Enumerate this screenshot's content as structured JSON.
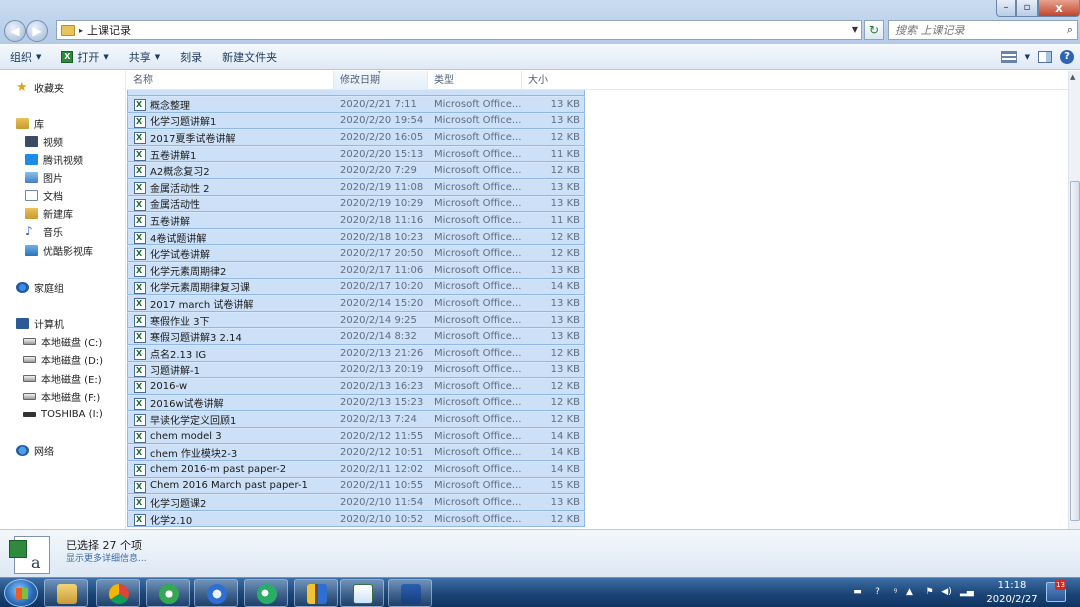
{
  "window": {
    "minimize_glyph": "–",
    "maximize_glyph": "▫",
    "close_glyph": "x"
  },
  "address": {
    "breadcrumb": "上课记录",
    "separator": "▸"
  },
  "search": {
    "placeholder": "搜索 上课记录"
  },
  "toolbar": {
    "organize": "组织",
    "open": "打开",
    "share": "共享",
    "burn": "刻录",
    "new_folder": "新建文件夹"
  },
  "nav": {
    "favorites": "收藏夹",
    "libraries": "库",
    "video": "视频",
    "tencent_video": "腾讯视频",
    "pictures": "图片",
    "documents": "文档",
    "new_library": "新建库",
    "music": "音乐",
    "youku": "优酷影视库",
    "homegroup": "家庭组",
    "computer": "计算机",
    "disk_c": "本地磁盘 (C:)",
    "disk_d": "本地磁盘 (D:)",
    "disk_e": "本地磁盘 (E:)",
    "disk_f": "本地磁盘 (F:)",
    "toshiba": "TOSHIBA (I:)",
    "network": "网络"
  },
  "columns": {
    "name": "名称",
    "date": "修改日期",
    "type": "类型",
    "size": "大小"
  },
  "files": [
    {
      "name": "概念整理",
      "date": "2020/2/21 7:11",
      "type": "Microsoft Office...",
      "size": "13 KB"
    },
    {
      "name": "化学习题讲解1",
      "date": "2020/2/20 19:54",
      "type": "Microsoft Office...",
      "size": "13 KB"
    },
    {
      "name": "2017夏季试卷讲解",
      "date": "2020/2/20 16:05",
      "type": "Microsoft Office...",
      "size": "12 KB"
    },
    {
      "name": "五卷讲解1",
      "date": "2020/2/20 15:13",
      "type": "Microsoft Office...",
      "size": "11 KB"
    },
    {
      "name": "A2概念复习2",
      "date": "2020/2/20 7:29",
      "type": "Microsoft Office...",
      "size": "12 KB"
    },
    {
      "name": "金属活动性 2",
      "date": "2020/2/19 11:08",
      "type": "Microsoft Office...",
      "size": "13 KB"
    },
    {
      "name": "金属活动性",
      "date": "2020/2/19 10:29",
      "type": "Microsoft Office...",
      "size": "13 KB"
    },
    {
      "name": "五卷讲解",
      "date": "2020/2/18 11:16",
      "type": "Microsoft Office...",
      "size": "11 KB"
    },
    {
      "name": "4卷试题讲解",
      "date": "2020/2/18 10:23",
      "type": "Microsoft Office...",
      "size": "12 KB"
    },
    {
      "name": "化学试卷讲解",
      "date": "2020/2/17 20:50",
      "type": "Microsoft Office...",
      "size": "12 KB"
    },
    {
      "name": "化学元素周期律2",
      "date": "2020/2/17 11:06",
      "type": "Microsoft Office...",
      "size": "13 KB"
    },
    {
      "name": "化学元素周期律复习课",
      "date": "2020/2/17 10:20",
      "type": "Microsoft Office...",
      "size": "14 KB"
    },
    {
      "name": "2017 march 试卷讲解",
      "date": "2020/2/14 15:20",
      "type": "Microsoft Office...",
      "size": "13 KB"
    },
    {
      "name": "寒假作业 3下",
      "date": "2020/2/14 9:25",
      "type": "Microsoft Office...",
      "size": "13 KB"
    },
    {
      "name": "寒假习题讲解3 2.14",
      "date": "2020/2/14 8:32",
      "type": "Microsoft Office...",
      "size": "13 KB"
    },
    {
      "name": "点名2.13 IG",
      "date": "2020/2/13 21:26",
      "type": "Microsoft Office...",
      "size": "12 KB"
    },
    {
      "name": "习题讲解-1",
      "date": "2020/2/13 20:19",
      "type": "Microsoft Office...",
      "size": "13 KB"
    },
    {
      "name": "2016-w",
      "date": "2020/2/13 16:23",
      "type": "Microsoft Office...",
      "size": "12 KB"
    },
    {
      "name": "2016w试卷讲解",
      "date": "2020/2/13 15:23",
      "type": "Microsoft Office...",
      "size": "12 KB"
    },
    {
      "name": "早读化学定义回顾1",
      "date": "2020/2/13 7:24",
      "type": "Microsoft Office...",
      "size": "12 KB"
    },
    {
      "name": "chem model 3",
      "date": "2020/2/12 11:55",
      "type": "Microsoft Office...",
      "size": "14 KB"
    },
    {
      "name": "chem 作业模块2-3",
      "date": "2020/2/12 10:51",
      "type": "Microsoft Office...",
      "size": "14 KB"
    },
    {
      "name": "chem 2016-m past paper-2",
      "date": "2020/2/11 12:02",
      "type": "Microsoft Office...",
      "size": "14 KB"
    },
    {
      "name": "Chem 2016 March past paper-1",
      "date": "2020/2/11 10:55",
      "type": "Microsoft Office...",
      "size": "15 KB"
    },
    {
      "name": "化学习题课2",
      "date": "2020/2/10 11:54",
      "type": "Microsoft Office...",
      "size": "13 KB"
    },
    {
      "name": "化学2.10",
      "date": "2020/2/10 10:52",
      "type": "Microsoft Office...",
      "size": "12 KB"
    }
  ],
  "details": {
    "selected": "已选择 27 个项",
    "show_more": "显示更多详细信息..."
  },
  "taskbar": {
    "time": "11:18",
    "date": "2020/2/27",
    "badge": "13"
  }
}
